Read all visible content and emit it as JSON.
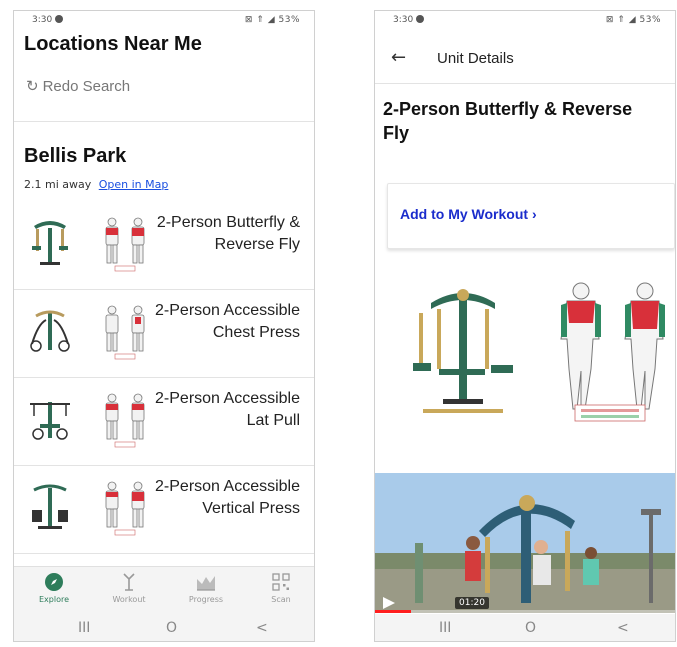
{
  "left_screen": {
    "status": {
      "time": "3:30",
      "system": "⊠ ⇑ ◢ 53%"
    },
    "title": "Locations Near Me",
    "redo_search": "Redo Search",
    "park": {
      "name": "Bellis Park",
      "distance": "2.1 mi away",
      "open_in_map": "Open in Map"
    },
    "units": [
      {
        "name": "2-Person Butterfly & Reverse Fly",
        "equipment_icon": "butterfly-machine-icon",
        "muscle_icon": "upper-back-chest-muscles-icon"
      },
      {
        "name": "2-Person Accessible Chest Press",
        "equipment_icon": "chest-press-machine-icon",
        "muscle_icon": "chest-muscles-icon"
      },
      {
        "name": "2-Person Accessible Lat Pull",
        "equipment_icon": "lat-pull-machine-icon",
        "muscle_icon": "lat-muscles-icon"
      },
      {
        "name": "2-Person Accessible Vertical Press",
        "equipment_icon": "vertical-press-machine-icon",
        "muscle_icon": "shoulder-muscles-icon"
      }
    ],
    "bottom_nav": [
      {
        "label": "Explore",
        "icon": "compass-icon",
        "active": true
      },
      {
        "label": "Workout",
        "icon": "workout-icon",
        "active": false
      },
      {
        "label": "Progress",
        "icon": "chart-icon",
        "active": false
      },
      {
        "label": "Scan",
        "icon": "qr-code-icon",
        "active": false
      }
    ],
    "system_nav": {
      "recents": "III",
      "home": "O",
      "back": "<"
    }
  },
  "right_screen": {
    "status": {
      "time": "3:30",
      "system": "⊠ ⇑ ◢ 53%"
    },
    "header_title": "Unit Details",
    "unit_title": "2-Person Butterfly & Reverse Fly",
    "add_to_workout": "Add to My Workout",
    "add_chevron": "›",
    "video": {
      "timestamp": "01:20",
      "progress": 0.12
    },
    "system_nav": {
      "recents": "III",
      "home": "O",
      "back": "<"
    }
  },
  "colors": {
    "accent_green": "#2e7d5b",
    "link_blue": "#1a4fe0",
    "cta_blue": "#1a2ccc",
    "equipment_green": "#2f6b55",
    "muscle_red": "#d8303a"
  }
}
